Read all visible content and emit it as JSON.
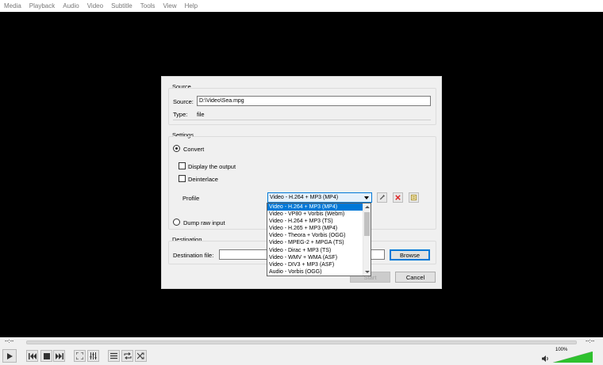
{
  "menu": [
    "Media",
    "Playback",
    "Audio",
    "Video",
    "Subtitle",
    "Tools",
    "View",
    "Help"
  ],
  "dialog": {
    "source_group": "Source",
    "source_label": "Source:",
    "source_value": "D:\\Video\\Sea.mpg",
    "type_label": "Type:",
    "type_value": "file",
    "settings_group": "Settings",
    "convert_label": "Convert",
    "display_output_label": "Display the output",
    "deinterlace_label": "Deinterlace",
    "profile_label": "Profile",
    "profile_selected": "Video - H.264 + MP3 (MP4)",
    "dump_raw_label": "Dump raw input",
    "destination_group": "Destination",
    "destination_file_label": "Destination file:",
    "destination_value": "",
    "browse_label": "Browse",
    "start_label": "Start",
    "cancel_label": "Cancel",
    "profile_options": [
      "Video - H.264 + MP3 (MP4)",
      "Video - VP80 + Vorbis (Webm)",
      "Video - H.264 + MP3 (TS)",
      "Video - H.265 + MP3 (MP4)",
      "Video - Theora + Vorbis (OGG)",
      "Video - MPEG-2 + MPGA (TS)",
      "Video - Dirac + MP3 (TS)",
      "Video - WMV + WMA (ASF)",
      "Video - DIV3 + MP3 (ASF)",
      "Audio - Vorbis (OGG)"
    ]
  },
  "player": {
    "time_left": "--:--",
    "time_right": "--:--",
    "volume": "100%",
    "volume_level": 1.0
  },
  "colors": {
    "accent": "#0078d7",
    "volume_fill": "#2ec12e"
  }
}
